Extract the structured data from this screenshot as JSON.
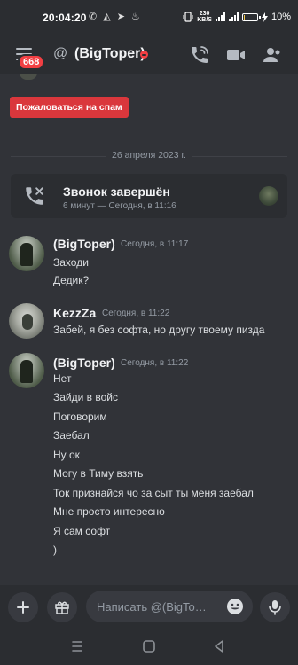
{
  "status_bar": {
    "time": "20:04:20",
    "app_icons": "✆ ◭ ➤ ♨",
    "net_speed_top": "230",
    "net_speed_bottom": "KB/S",
    "battery_text": "10%",
    "battery_level": 0.1
  },
  "header": {
    "unread_badge": "668",
    "at_symbol": "@",
    "title": "(BigToper)",
    "status_color": "#f23f43",
    "actions": [
      "phone-call-icon",
      "video-camera-icon",
      "members-icon"
    ]
  },
  "spam_button": {
    "label": "Пожаловаться на спам"
  },
  "date_divider": {
    "label": "26 апреля 2023 г."
  },
  "call_card": {
    "title": "Звонок завершён",
    "subtitle": "6 минут — Сегодня, в 11:16"
  },
  "messages": [
    {
      "author": "(BigToper)",
      "timestamp": "Сегодня, в 11:17",
      "lines": [
        "Заходи",
        "Дедик?"
      ]
    },
    {
      "author": "KezzZa",
      "timestamp": "Сегодня, в 11:22",
      "lines": [
        "Забей, я без софта, но другу твоему пизда"
      ]
    },
    {
      "author": "(BigToper)",
      "timestamp": "Сегодня, в 11:22",
      "lines": [
        "Нет",
        "Зайди в войс",
        "Поговорим",
        "Заебал",
        "Ну ок",
        "Могу в Тиму взять",
        "Ток признайся чо за сыт ты меня заебал",
        "Мне просто интересно",
        "Я сам софт",
        ")"
      ]
    }
  ],
  "composer": {
    "placeholder": "Написать @(BigTo…"
  },
  "colors": {
    "background": "#313338",
    "panel": "#2b2d31",
    "danger": "#da373c",
    "text_muted": "#949ba4"
  }
}
